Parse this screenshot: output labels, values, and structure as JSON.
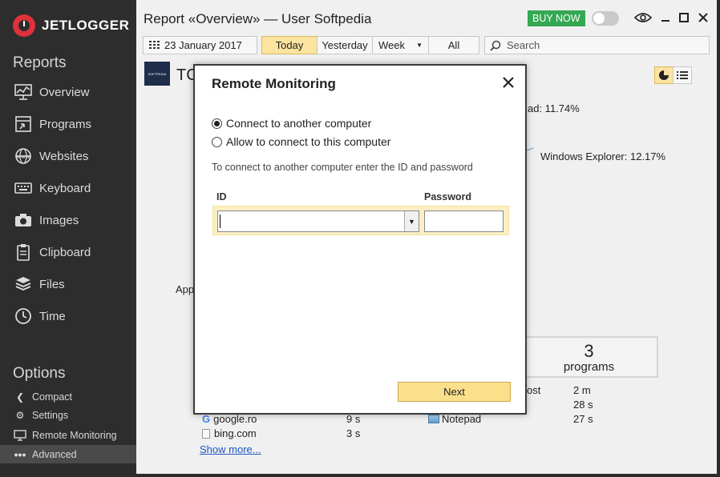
{
  "app": {
    "logo_text": "JETLOGGER",
    "window_title": "Report «Overview» — User Softpedia",
    "buy_now_label": "BUY NOW",
    "accent_color": "#e0313a",
    "buy_color": "#35a853"
  },
  "sidebar": {
    "reports_title": "Reports",
    "reports": [
      {
        "label": "Overview",
        "icon": "chart-icon"
      },
      {
        "label": "Programs",
        "icon": "programs-icon"
      },
      {
        "label": "Websites",
        "icon": "globe-icon"
      },
      {
        "label": "Keyboard",
        "icon": "keyboard-icon"
      },
      {
        "label": "Images",
        "icon": "camera-icon"
      },
      {
        "label": "Clipboard",
        "icon": "clipboard-icon"
      },
      {
        "label": "Files",
        "icon": "files-icon"
      },
      {
        "label": "Time",
        "icon": "clock-icon"
      }
    ],
    "options_title": "Options",
    "options": [
      {
        "label": "Compact",
        "icon": "chevron-left-icon"
      },
      {
        "label": "Settings",
        "icon": "gear-icon"
      },
      {
        "label": "Remote Monitoring",
        "icon": "monitor-icon"
      },
      {
        "label": "Advanced",
        "icon": "more-icon",
        "active": true
      }
    ]
  },
  "toolbar": {
    "date": "23 January 2017",
    "today": "Today",
    "yesterday": "Yesterday",
    "week": "Week",
    "all": "All",
    "search_placeholder": "Search"
  },
  "report": {
    "heading_partial": "TC",
    "logo_text": "SOFTPEDIA",
    "legend_1": "ad: 11.74%",
    "legend_2": "Windows Explorer: 12.17%",
    "apps_partial": "App",
    "programs_count": "3",
    "programs_label": "programs",
    "sites": [
      {
        "name": "google.ro",
        "time": "9 s"
      },
      {
        "name": "bing.com",
        "time": "3 s"
      }
    ],
    "programs": [
      {
        "name": "ost",
        "time": "2 m"
      },
      {
        "name": "",
        "time": "28 s"
      },
      {
        "name": "Notepad",
        "time": "27 s"
      }
    ],
    "show_more": "Show more..."
  },
  "modal": {
    "title": "Remote Monitoring",
    "option_connect": "Connect to another computer",
    "option_allow": "Allow to connect to this computer",
    "selected_option": "connect",
    "hint": "To connect to another computer enter the ID and password",
    "id_label": "ID",
    "password_label": "Password",
    "id_value": "",
    "password_value": "",
    "next_label": "Next"
  }
}
